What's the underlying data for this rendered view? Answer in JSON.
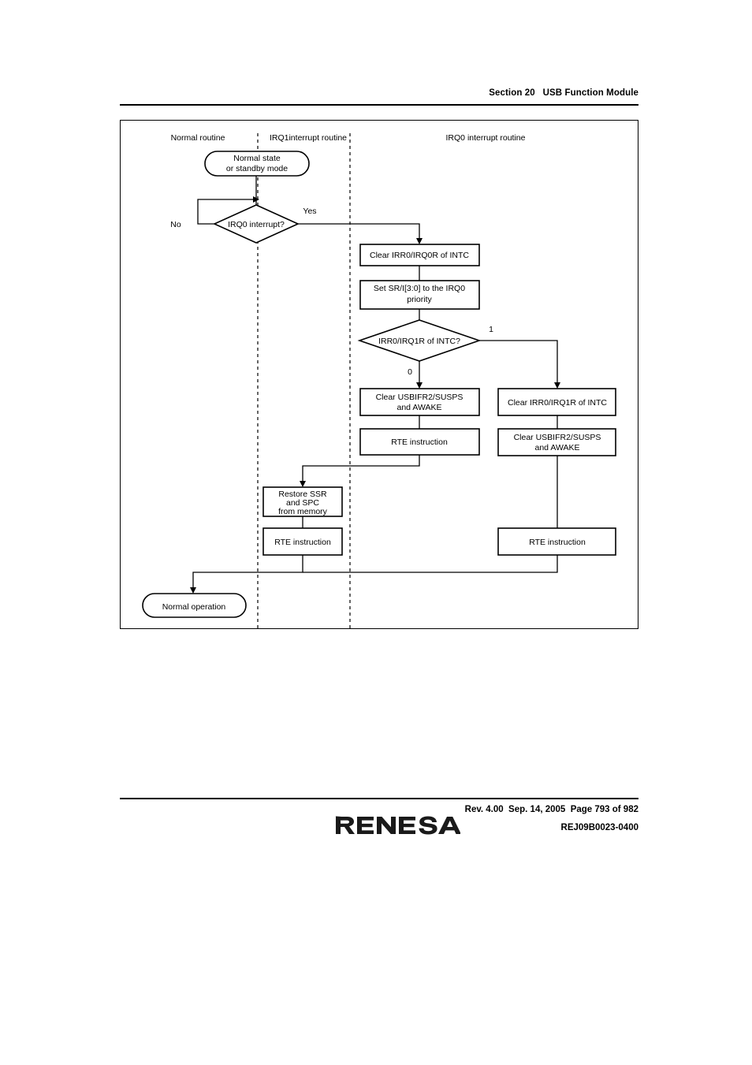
{
  "header": {
    "section": "Section 20   USB Function Module"
  },
  "figure": {
    "lanes": [
      {
        "label": "Normal routine"
      },
      {
        "label": "IRQ1interrupt routine"
      },
      {
        "label": "IRQ0 interrupt routine"
      }
    ],
    "nodes": {
      "start_terminal": "Normal state\nor standby mode",
      "start_terminal_line1": "Normal state",
      "start_terminal_line2": "or standby mode",
      "decision1": "IRQ0 interrupt?",
      "clear_irr0_irq0r": "Clear IRR0/IRQ0R of INTC",
      "set_sr_line1": "Set SR/I[3:0] to the IRQ0",
      "set_sr_line2": "priority",
      "decision2": "IRR0/IRQ1R of INTC?",
      "clear_usbifr2_left_line1": "Clear USBIFR2/SUSPS",
      "clear_usbifr2_left_line2": "and AWAKE",
      "rte_middle": "RTE instruction",
      "clear_irr0_irq1r": "Clear IRR0/IRQ1R of INTC",
      "clear_usbifr2_right_line1": "Clear USBIFR2/SUSPS",
      "clear_usbifr2_right_line2": "and AWAKE",
      "restore_ssr_line1": "Restore SSR",
      "restore_ssr_line2": "and SPC",
      "restore_ssr_line3": "from memory",
      "rte_left": "RTE instruction",
      "rte_right": "RTE instruction",
      "end_terminal": "Normal operation"
    },
    "edge_labels": {
      "no": "No",
      "yes": "Yes",
      "one": "1",
      "zero": "0"
    }
  },
  "footer": {
    "revision_line": "Rev. 4.00  Sep. 14, 2005  Page 793 of 982",
    "document_code": "REJ09B0023-0400",
    "logo_text": "RENESAS"
  }
}
